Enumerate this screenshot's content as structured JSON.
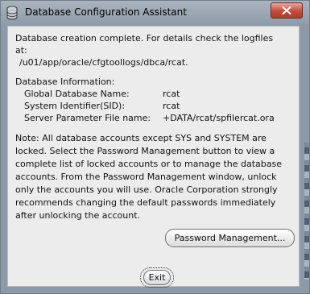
{
  "window": {
    "title": "Database Configuration Assistant",
    "accent_titlebar": "#9aa6b2",
    "close_button_color": "#c24b3b"
  },
  "message": {
    "completion_line1": "Database creation complete. For details check the logfiles",
    "completion_line2": "at:",
    "log_path": "/u01/app/oracle/cfgtoollogs/dbca/rcat.",
    "info_heading": "Database Information:",
    "info": [
      {
        "label": "Global Database Name:",
        "value": "rcat"
      },
      {
        "label": "System Identifier(SID):",
        "value": "rcat"
      },
      {
        "label": "Server Parameter File name:",
        "value": "+DATA/rcat/spfilercat.ora"
      }
    ],
    "note_lines": [
      "Note: All database accounts except SYS and SYSTEM are",
      "locked. Select the Password Management button to view a",
      "complete list of locked accounts or to manage the database",
      "accounts. From the Password Management window, unlock",
      "only the accounts you will use. Oracle Corporation strongly",
      "recommends changing the default passwords immediately",
      "after unlocking the account."
    ]
  },
  "buttons": {
    "password_management": "Password Management...",
    "exit": "Exit"
  },
  "icons": {
    "app": "database-icon",
    "close": "close-icon"
  }
}
